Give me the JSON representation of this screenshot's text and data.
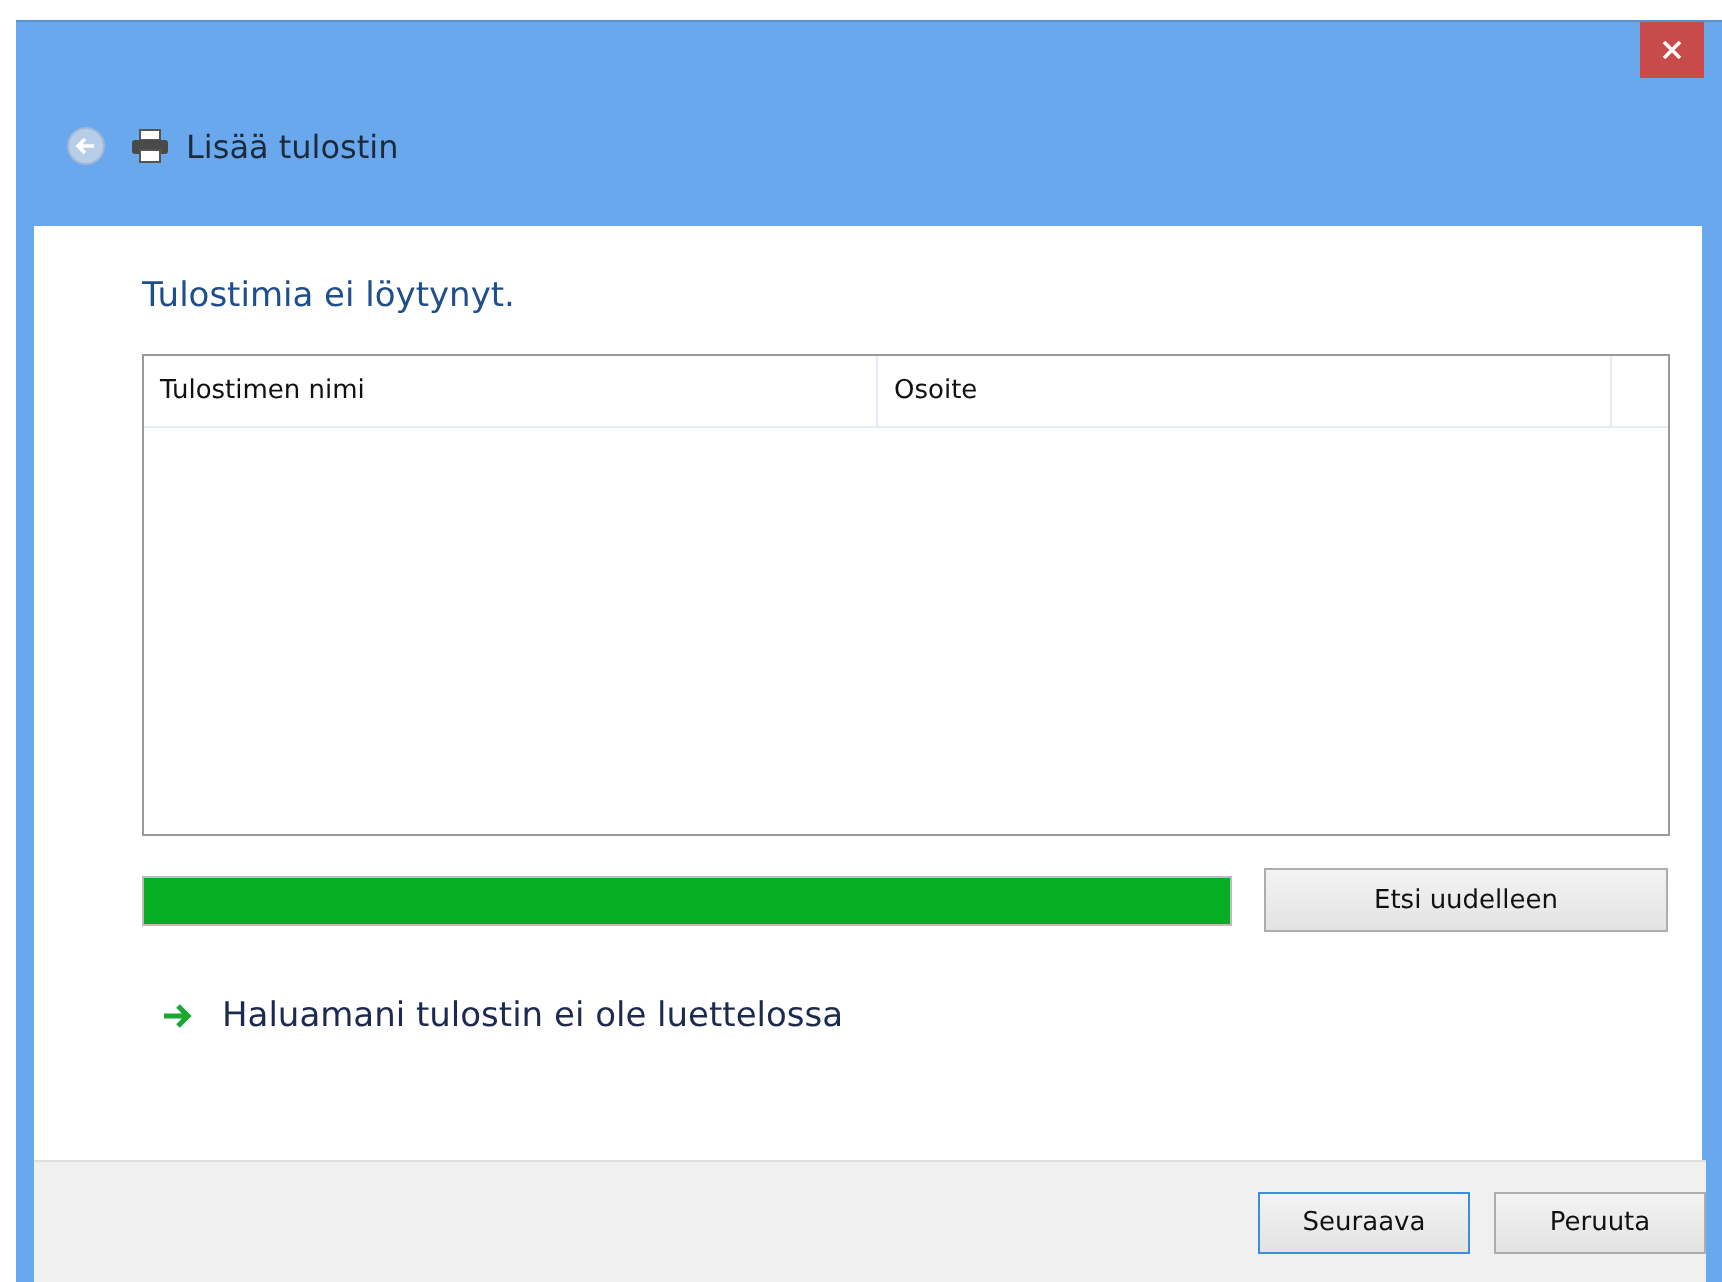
{
  "window": {
    "title": "Lisää tulostin"
  },
  "heading": "Tulostimia ei löytynyt.",
  "table": {
    "columns": [
      "Tulostimen nimi",
      "Osoite"
    ]
  },
  "progress": {
    "level": 1
  },
  "search_again_button": "Etsi uudelleen",
  "link": "Haluamani tulostin ei ole luettelossa",
  "buttons": [
    {
      "label": "Seuraava",
      "selected": true
    },
    {
      "label": "Peruuta",
      "selected": false
    }
  ]
}
